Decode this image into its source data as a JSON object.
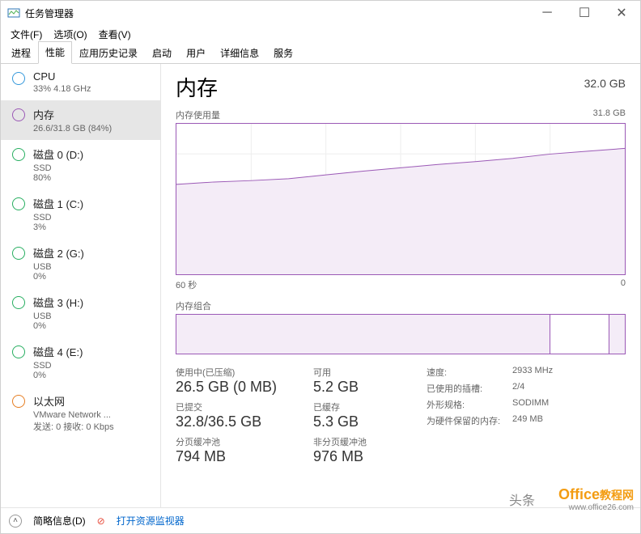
{
  "window": {
    "title": "任务管理器"
  },
  "menu": {
    "file": "文件(F)",
    "options": "选项(O)",
    "view": "查看(V)"
  },
  "tabs": [
    "进程",
    "性能",
    "应用历史记录",
    "启动",
    "用户",
    "详细信息",
    "服务"
  ],
  "active_tab": 1,
  "sidebar": {
    "items": [
      {
        "name": "CPU",
        "sub": "33% 4.18 GHz",
        "color": "#3498db"
      },
      {
        "name": "内存",
        "sub": "26.6/31.8 GB (84%)",
        "color": "#9b59b6"
      },
      {
        "name": "磁盘 0 (D:)",
        "sub": "SSD",
        "sub2": "80%",
        "color": "#27ae60"
      },
      {
        "name": "磁盘 1 (C:)",
        "sub": "SSD",
        "sub2": "3%",
        "color": "#27ae60"
      },
      {
        "name": "磁盘 2 (G:)",
        "sub": "USB",
        "sub2": "0%",
        "color": "#27ae60"
      },
      {
        "name": "磁盘 3 (H:)",
        "sub": "USB",
        "sub2": "0%",
        "color": "#27ae60"
      },
      {
        "name": "磁盘 4 (E:)",
        "sub": "SSD",
        "sub2": "0%",
        "color": "#27ae60"
      },
      {
        "name": "以太网",
        "sub": "VMware Network ...",
        "sub2": "发送: 0 接收: 0 Kbps",
        "color": "#e67e22"
      }
    ],
    "selected": 1
  },
  "main": {
    "title": "内存",
    "capacity": "32.0 GB",
    "usage_label": "内存使用量",
    "usage_max": "31.8 GB",
    "x_left": "60 秒",
    "x_right": "0",
    "comp_label": "内存组合",
    "stats_left": [
      {
        "label": "使用中(已压缩)",
        "value": "26.5 GB (0 MB)"
      },
      {
        "label": "已提交",
        "value": "32.8/36.5 GB"
      },
      {
        "label": "分页缓冲池",
        "value": "794 MB"
      }
    ],
    "stats_mid": [
      {
        "label": "可用",
        "value": "5.2 GB"
      },
      {
        "label": "已缓存",
        "value": "5.3 GB"
      },
      {
        "label": "非分页缓冲池",
        "value": "976 MB"
      }
    ],
    "kv": [
      {
        "k": "速度:",
        "v": "2933 MHz"
      },
      {
        "k": "已使用的插槽:",
        "v": "2/4"
      },
      {
        "k": "外形规格:",
        "v": "SODIMM"
      },
      {
        "k": "为硬件保留的内存:",
        "v": "249 MB"
      }
    ]
  },
  "bottom": {
    "simple": "简略信息(D)",
    "monitor": "打开资源监视器"
  },
  "watermark": {
    "site": "www.office26.com",
    "brand1": "Office",
    "brand2": "教程网",
    "tt": "头条"
  },
  "chart_data": {
    "type": "line",
    "title": "内存使用量",
    "xlabel": "秒",
    "ylabel": "GB",
    "x": [
      60,
      55,
      50,
      45,
      40,
      35,
      30,
      25,
      20,
      15,
      10,
      5,
      0
    ],
    "values": [
      19.0,
      19.5,
      19.8,
      20.2,
      21.0,
      21.8,
      22.5,
      23.2,
      23.8,
      24.5,
      25.4,
      26.0,
      26.6
    ],
    "ylim": [
      0,
      31.8
    ]
  },
  "comp_data": {
    "used_pct": 83.3,
    "standby_pct": 3.5
  }
}
